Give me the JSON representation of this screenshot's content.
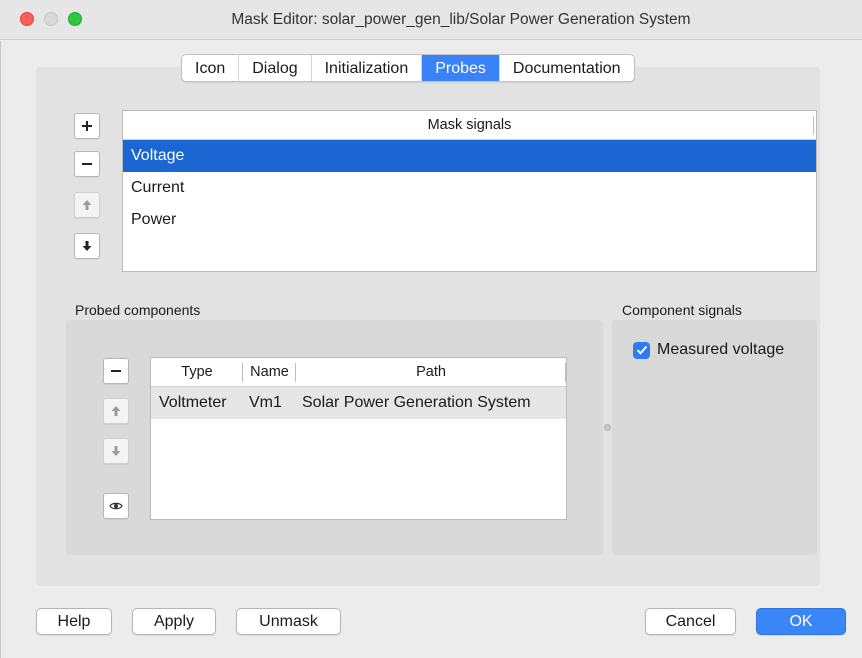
{
  "window": {
    "title": "Mask Editor: solar_power_gen_lib/Solar Power Generation System"
  },
  "tabs": [
    {
      "label": "Icon",
      "active": false
    },
    {
      "label": "Dialog",
      "active": false
    },
    {
      "label": "Initialization",
      "active": false
    },
    {
      "label": "Probes",
      "active": true
    },
    {
      "label": "Documentation",
      "active": false
    }
  ],
  "mask_signals": {
    "header": "Mask signals",
    "items": [
      {
        "label": "Voltage",
        "selected": true
      },
      {
        "label": "Current",
        "selected": false
      },
      {
        "label": "Power",
        "selected": false
      }
    ],
    "toolbar": [
      "plus-icon",
      "minus-icon",
      "arrow-up-icon",
      "arrow-down-icon"
    ]
  },
  "probed_components": {
    "label": "Probed components",
    "columns": [
      "Type",
      "Name",
      "Path"
    ],
    "rows": [
      {
        "type": "Voltmeter",
        "name": "Vm1",
        "path": "Solar Power Generation System"
      }
    ],
    "toolbar": [
      "minus-icon",
      "arrow-up-icon",
      "arrow-down-icon",
      "eye-icon"
    ]
  },
  "component_signals": {
    "label": "Component signals",
    "items": [
      {
        "label": "Measured voltage",
        "checked": true
      }
    ]
  },
  "buttons": {
    "help": "Help",
    "apply": "Apply",
    "unmask": "Unmask",
    "cancel": "Cancel",
    "ok": "OK"
  },
  "colors": {
    "accent": "#3a82f7",
    "selection": "#1a66d2"
  }
}
